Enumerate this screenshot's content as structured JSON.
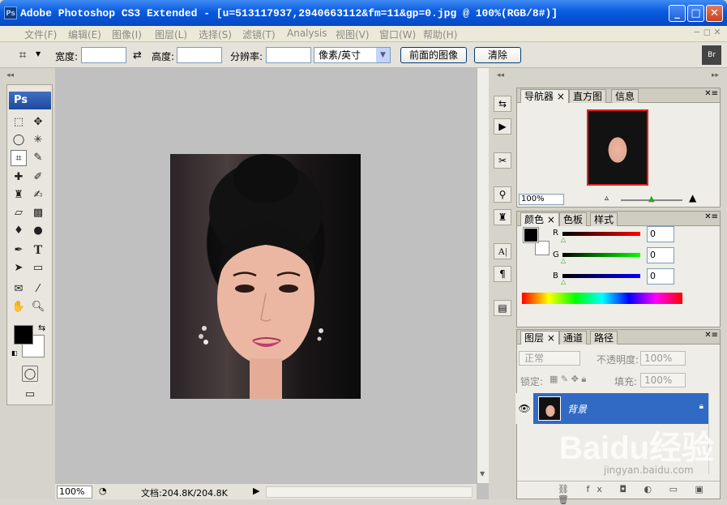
{
  "window": {
    "title": "Adobe Photoshop CS3 Extended - [u=513117937,2940663112&fm=11&gp=0.jpg @ 100%(RGB/8#)]",
    "app_icon": "Ps",
    "minimize": "_",
    "maximize": "□",
    "close": "✕"
  },
  "menu": [
    {
      "label": "文件(F)"
    },
    {
      "label": "编辑(E)"
    },
    {
      "label": "图像(I)"
    },
    {
      "label": "图层(L)"
    },
    {
      "label": "选择(S)"
    },
    {
      "label": "滤镜(T)"
    },
    {
      "label": "Analysis"
    },
    {
      "label": "视图(V)"
    },
    {
      "label": "窗口(W)"
    },
    {
      "label": "帮助(H)"
    }
  ],
  "options": {
    "width_label": "宽度:",
    "width_value": "",
    "height_label": "高度:",
    "height_value": "",
    "resolution_label": "分辨率:",
    "resolution_value": "",
    "unit": "像素/英寸",
    "front_image_button": "前面的图像",
    "clear_button": "清除"
  },
  "toolbox": {
    "logo": "Ps"
  },
  "status": {
    "zoom": "100%",
    "doc": "文档:204.8K/204.8K"
  },
  "navigator": {
    "tabs": [
      "导航器",
      "直方图",
      "信息"
    ],
    "zoom": "100%"
  },
  "color_panel": {
    "tabs": [
      "颜色",
      "色板",
      "样式"
    ],
    "r_label": "R",
    "g_label": "G",
    "b_label": "B",
    "r": "0",
    "g": "0",
    "b": "0"
  },
  "layers_panel": {
    "tabs": [
      "图层",
      "通道",
      "路径"
    ],
    "blend_mode": "正常",
    "opacity_label": "不透明度:",
    "opacity": "100%",
    "lock_label": "锁定:",
    "fill_label": "填充:",
    "fill": "100%",
    "layer_name": "背景"
  },
  "watermark": {
    "brand": "Baidu经验",
    "url": "jingyan.baidu.com"
  }
}
